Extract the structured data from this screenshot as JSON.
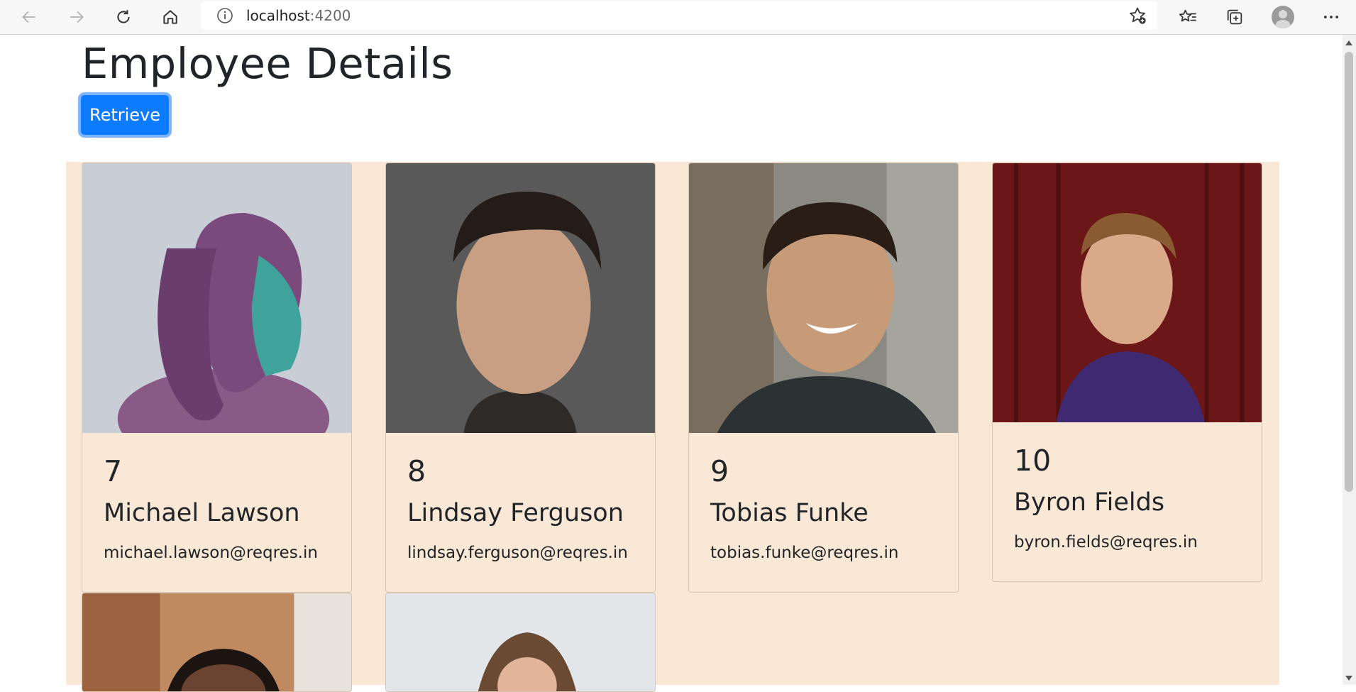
{
  "browser": {
    "url_host": "localhost",
    "url_port": ":4200",
    "icons": [
      "back-icon",
      "forward-icon",
      "refresh-icon",
      "home-icon",
      "info-icon",
      "add-favorite-icon",
      "favorites-icon",
      "collections-icon",
      "profile-avatar",
      "more-icon"
    ]
  },
  "page": {
    "title": "Employee Details",
    "retrieve_label": "Retrieve"
  },
  "colors": {
    "accent": "#0d7bff",
    "card_background": "#f9e8d5"
  },
  "employees": [
    {
      "id": "7",
      "name": "Michael Lawson",
      "email": "michael.lawson@reqres.in"
    },
    {
      "id": "8",
      "name": "Lindsay Ferguson",
      "email": "lindsay.ferguson@reqres.in"
    },
    {
      "id": "9",
      "name": "Tobias Funke",
      "email": "tobias.funke@reqres.in"
    },
    {
      "id": "10",
      "name": "Byron Fields",
      "email": "byron.fields@reqres.in"
    }
  ]
}
